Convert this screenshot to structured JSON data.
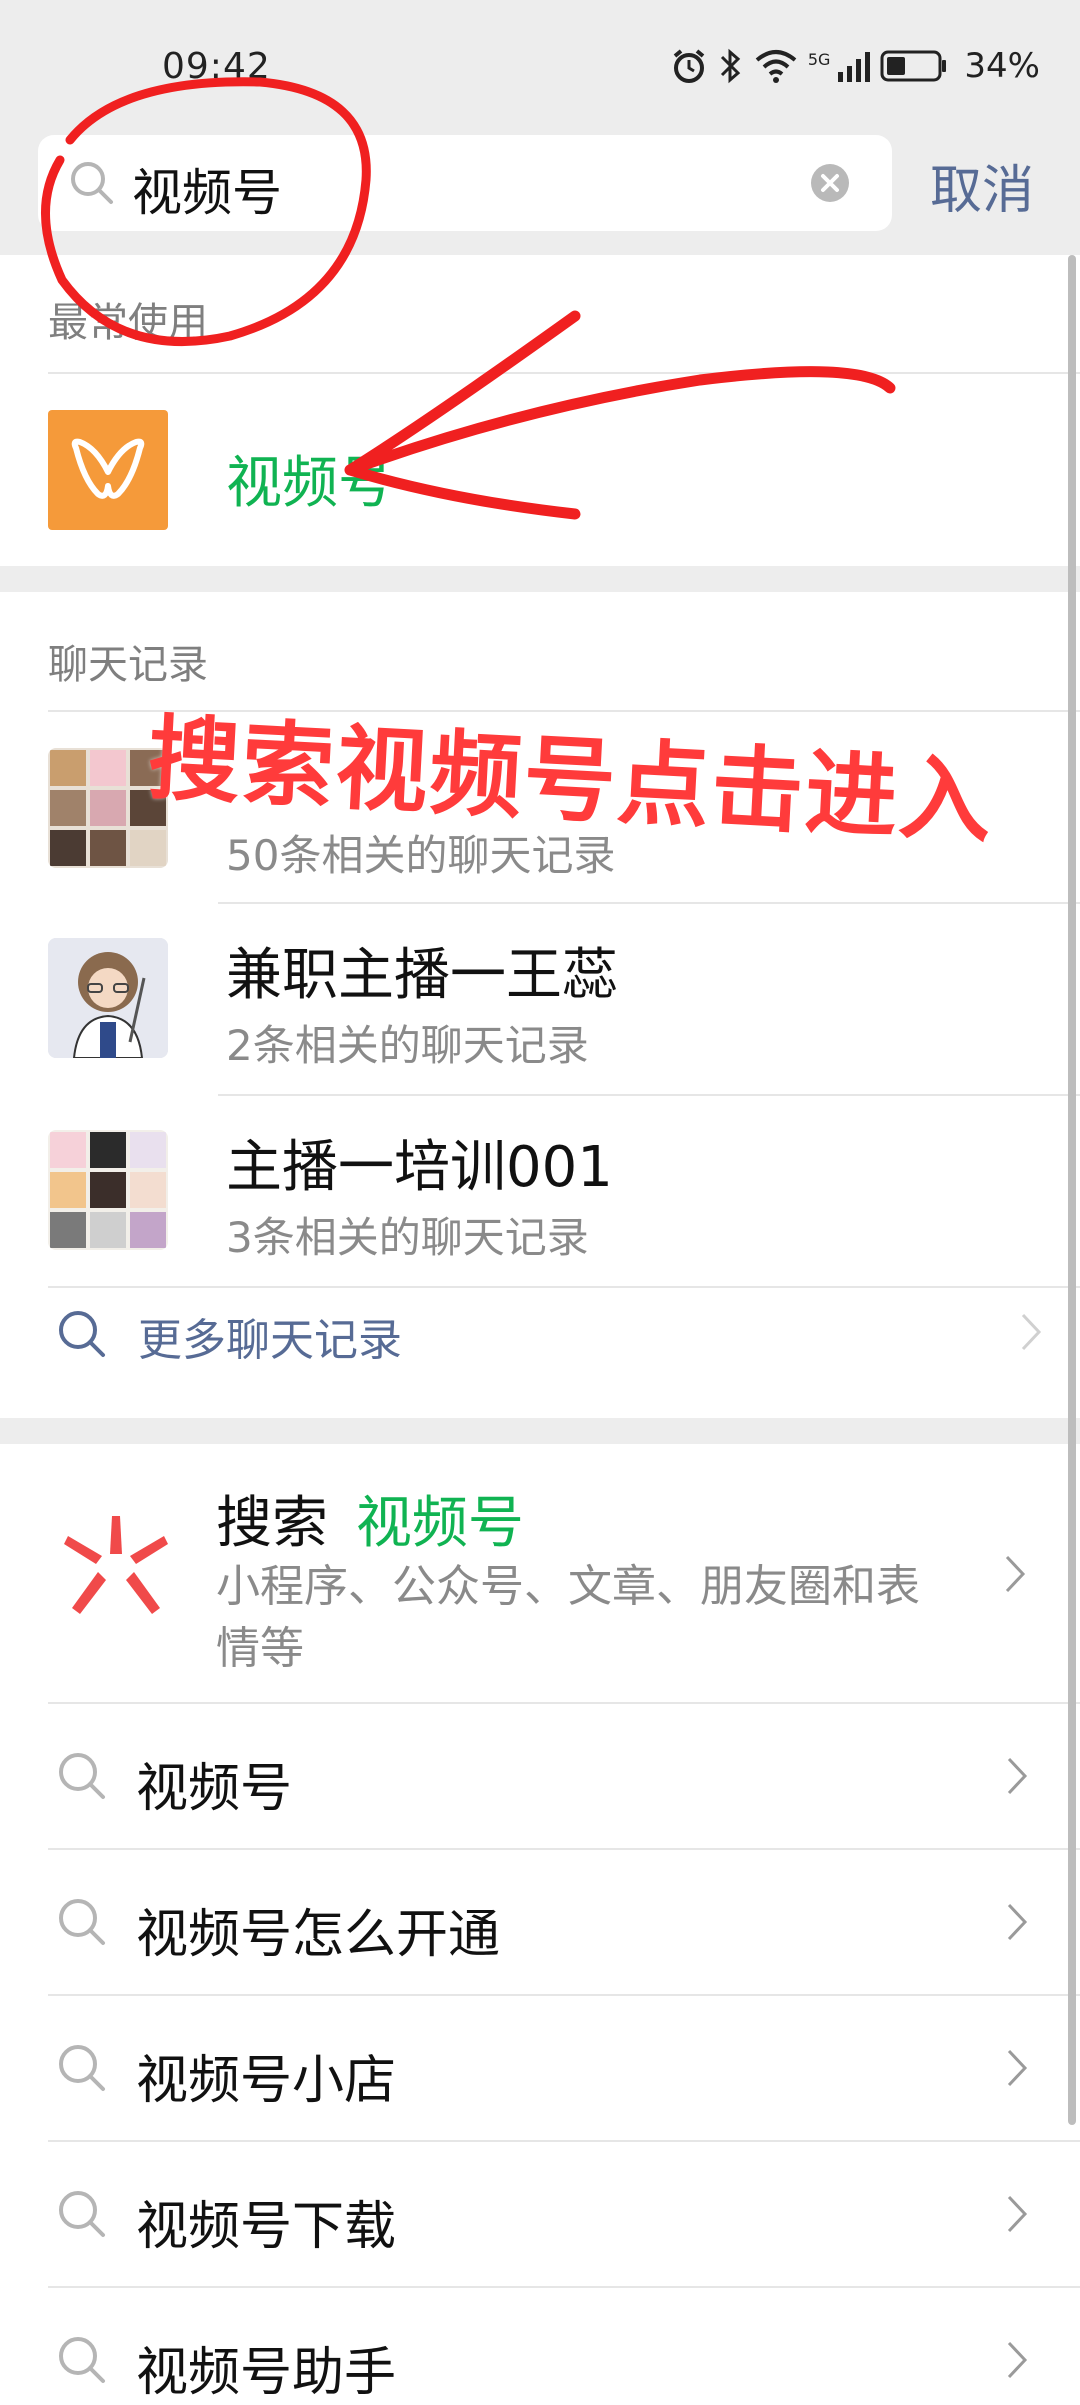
{
  "status": {
    "time": "09:42",
    "network": "5G",
    "battery": "34%"
  },
  "search": {
    "query": "视频号",
    "cancel_label": "取消"
  },
  "frequent": {
    "label": "最常使用",
    "item_title": "视频号",
    "icon_color": "#f59a3a"
  },
  "chats": {
    "label": "聊天记录",
    "items": [
      {
        "title": "",
        "subtitle": "50条相关的聊天记录"
      },
      {
        "title": "兼职主播一王蕊",
        "subtitle": "2条相关的聊天记录"
      },
      {
        "title": "主播一培训001",
        "subtitle": "3条相关的聊天记录"
      }
    ],
    "more_label": "更多聊天记录"
  },
  "sousuo": {
    "prefix": "搜索",
    "keyword": "视频号",
    "description": "小程序、公众号、文章、朋友圈和表情等"
  },
  "suggestions": [
    "视频号",
    "视频号怎么开通",
    "视频号小店",
    "视频号下载",
    "视频号助手"
  ],
  "annotation": {
    "text": "搜索视频号点击进入",
    "color": "#ff3b3b"
  },
  "colors": {
    "link": "#576b95",
    "green": "#10b352",
    "background": "#ededed"
  }
}
